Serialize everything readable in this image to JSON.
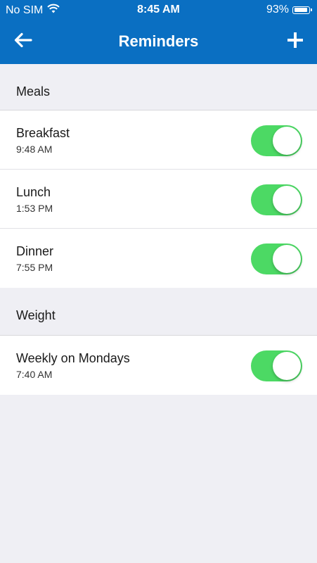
{
  "status_bar": {
    "carrier": "No SIM",
    "time": "8:45 AM",
    "battery_pct": "93%",
    "battery_level": 0.93
  },
  "nav": {
    "title": "Reminders",
    "back_icon": "arrow-left-icon",
    "add_icon": "plus-icon"
  },
  "sections": [
    {
      "title": "Meals",
      "items": [
        {
          "title": "Breakfast",
          "time": "9:48 AM",
          "enabled": true
        },
        {
          "title": "Lunch",
          "time": "1:53 PM",
          "enabled": true
        },
        {
          "title": "Dinner",
          "time": "7:55 PM",
          "enabled": true
        }
      ]
    },
    {
      "title": "Weight",
      "items": [
        {
          "title": "Weekly on Mondays",
          "time": "7:40 AM",
          "enabled": true
        }
      ]
    }
  ],
  "colors": {
    "header_blue": "#0a6fc2",
    "toggle_on": "#4cd964",
    "background": "#efeff4"
  }
}
